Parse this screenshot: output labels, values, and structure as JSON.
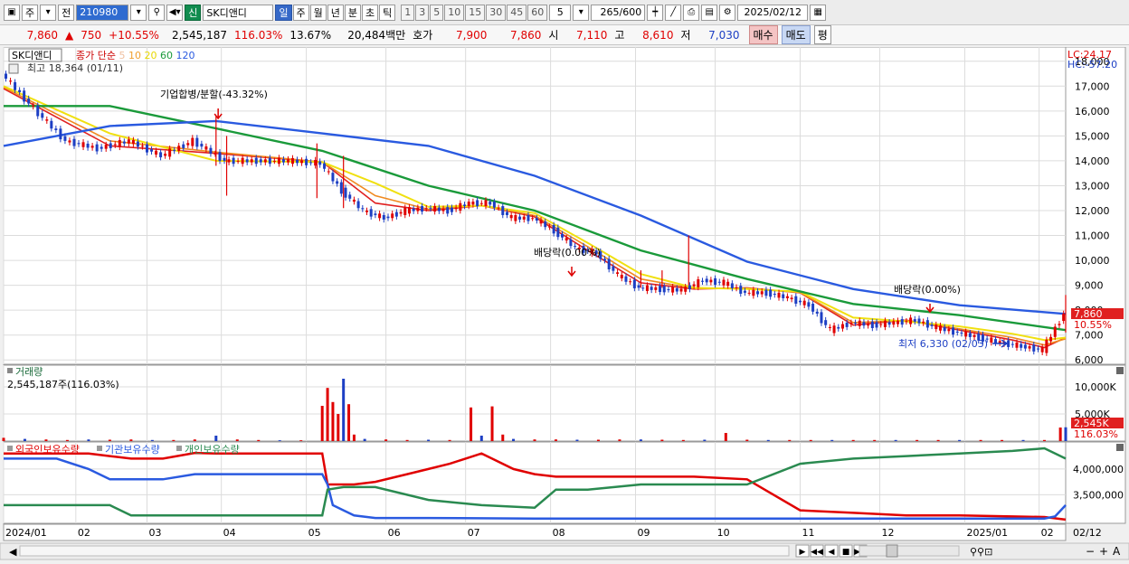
{
  "toolbar": {
    "period_type": "주",
    "market": "전",
    "code": "210980",
    "badge": "신",
    "stock_name": "SK디앤디",
    "periods": [
      "일",
      "주",
      "월",
      "년",
      "분",
      "초",
      "틱"
    ],
    "active_period": "일",
    "intervals": [
      "1",
      "3",
      "5",
      "10",
      "15",
      "30",
      "45",
      "60"
    ],
    "custom_interval": "5",
    "count": "265",
    "count_max": "/600",
    "date": "2025/02/12"
  },
  "quote": {
    "price": "7,860",
    "change": "750",
    "change_pct": "+10.55%",
    "volume": "2,545,187",
    "volume_ratio": "116.03%",
    "turnover": "13.67%",
    "amount": "20,484백만",
    "ask_label": "호가",
    "ask": "7,900",
    "bid": "7,860",
    "open_label": "시",
    "open": "7,110",
    "high_label": "고",
    "high": "8,610",
    "low_label": "저",
    "low": "7,030",
    "buy_label": "매수",
    "sell_label": "매도",
    "eval_label": "평"
  },
  "colors": {
    "up": "#e00000",
    "down": "#1d3fc4",
    "ma5": "#e02020",
    "ma10": "#f08a20",
    "ma20": "#f0e010",
    "ma60": "#1a9a3a",
    "ma120": "#2a5ae0",
    "foreign": "#e00000",
    "institution": "#2a5ae0",
    "individual": "#2a8a50"
  },
  "chart_data": [
    {
      "type": "line",
      "title": "SK디앤디",
      "legend": "종가 단순 5 10 20 60 120",
      "legend_items": [
        {
          "name": "5",
          "color": "#f0c0a0"
        },
        {
          "name": "10",
          "color": "#f0a030"
        },
        {
          "name": "20",
          "color": "#e8d800"
        },
        {
          "name": "60",
          "color": "#1a9a3a"
        },
        {
          "name": "120",
          "color": "#2a5ae0"
        }
      ],
      "max_label": "최고 18,364 (01/11)",
      "min_label": "최저 6,330 (02/03)",
      "annotations": [
        "기업합병/분할(-43.32%)",
        "배당락(0.00%)",
        "배당락(0.00%)"
      ],
      "right_top": [
        "LC:24.17",
        "HC:-57.20"
      ],
      "last_price": "7,860",
      "last_pct": "10.55%",
      "y_ticks": [
        "18,000",
        "17,000",
        "16,000",
        "15,000",
        "14,000",
        "13,000",
        "12,000",
        "11,000",
        "10,000",
        "9,000",
        "8,000",
        "7,000",
        "6,000"
      ],
      "ylim": [
        5900,
        18500
      ],
      "x_labels": [
        "2024/01",
        "02",
        "03",
        "04",
        "05",
        "06",
        "07",
        "08",
        "09",
        "10",
        "11",
        "12",
        "2025/01",
        "02"
      ],
      "x_label_last": "02/12",
      "series": [
        {
          "name": "close",
          "x": [
            0,
            3,
            6,
            9,
            12,
            15,
            18,
            21,
            24,
            27,
            30,
            32,
            34,
            36,
            38,
            40,
            42,
            44,
            46,
            48,
            50,
            52,
            54,
            56,
            58,
            60,
            62,
            64,
            66,
            68,
            70,
            72,
            74,
            76,
            78,
            80,
            82,
            84,
            86,
            88,
            90,
            92,
            94,
            96,
            98,
            100
          ],
          "values": [
            17500,
            16100,
            14800,
            14500,
            14800,
            14200,
            14800,
            14000,
            14000,
            14000,
            13900,
            12800,
            12000,
            11700,
            12000,
            12100,
            12000,
            12300,
            12300,
            11700,
            11700,
            11200,
            10500,
            10300,
            9400,
            8900,
            8850,
            8800,
            9200,
            9100,
            8700,
            8700,
            8500,
            8200,
            7200,
            7500,
            7400,
            7500,
            7600,
            7300,
            7100,
            6900,
            6700,
            6550,
            6400,
            7860
          ]
        },
        {
          "name": "5",
          "x": [
            0,
            10,
            20,
            30,
            35,
            40,
            45,
            50,
            55,
            60,
            65,
            70,
            75,
            80,
            85,
            90,
            95,
            98,
            100
          ],
          "values": [
            16900,
            14600,
            14300,
            13950,
            12300,
            12000,
            12200,
            11750,
            10400,
            9100,
            8850,
            8900,
            8700,
            7400,
            7600,
            7200,
            6800,
            6500,
            6900
          ]
        },
        {
          "name": "10",
          "x": [
            0,
            10,
            20,
            30,
            35,
            40,
            45,
            50,
            55,
            60,
            65,
            70,
            75,
            80,
            85,
            90,
            95,
            98,
            100
          ],
          "values": [
            16950,
            14800,
            14350,
            13950,
            12600,
            12050,
            12200,
            11800,
            10550,
            9250,
            8870,
            8880,
            8710,
            7500,
            7580,
            7250,
            6900,
            6600,
            6850
          ]
        },
        {
          "name": "20",
          "x": [
            0,
            10,
            20,
            30,
            35,
            40,
            45,
            50,
            55,
            60,
            65,
            70,
            75,
            80,
            85,
            90,
            95,
            98,
            100
          ],
          "values": [
            17000,
            15100,
            14000,
            13950,
            13100,
            12150,
            12200,
            11900,
            10700,
            9450,
            8900,
            8850,
            8740,
            7700,
            7550,
            7350,
            7050,
            6800,
            6900
          ]
        },
        {
          "name": "60",
          "x": [
            0,
            10,
            20,
            30,
            40,
            50,
            60,
            70,
            80,
            90,
            100
          ],
          "values": [
            16200,
            16200,
            15300,
            14400,
            13000,
            12000,
            10400,
            9250,
            8250,
            7800,
            7200
          ]
        },
        {
          "name": "120",
          "x": [
            0,
            10,
            20,
            30,
            40,
            50,
            60,
            70,
            80,
            90,
            100
          ],
          "values": [
            14600,
            15400,
            15600,
            15100,
            14600,
            13400,
            11800,
            9950,
            8850,
            8200,
            7850
          ]
        }
      ]
    },
    {
      "type": "bar",
      "title": "거래량",
      "subtitle": "2,545,187주(116.03%)",
      "y_ticks": [
        "10,000K",
        "5,000K"
      ],
      "ylim": [
        0,
        13000
      ],
      "last_label": "2,545K",
      "last_pct": "116.03%",
      "series": [
        {
          "name": "volume",
          "x": [
            0,
            2,
            4,
            6,
            8,
            10,
            12,
            14,
            16,
            18,
            20,
            22,
            24,
            26,
            28,
            30,
            30.5,
            31,
            31.5,
            32,
            32.5,
            33,
            34,
            36,
            38,
            40,
            42,
            44,
            45,
            46,
            47,
            48,
            50,
            52,
            54,
            56,
            58,
            60,
            62,
            64,
            66,
            68,
            70,
            72,
            74,
            76,
            78,
            80,
            82,
            84,
            86,
            88,
            90,
            92,
            94,
            96,
            98,
            99.5,
            100
          ],
          "values": [
            600,
            400,
            300,
            200,
            300,
            250,
            300,
            200,
            200,
            300,
            1000,
            300,
            200,
            150,
            150,
            6500,
            9800,
            7200,
            5000,
            11500,
            6800,
            1200,
            400,
            300,
            200,
            250,
            200,
            6200,
            1000,
            6400,
            1200,
            400,
            300,
            300,
            250,
            250,
            300,
            300,
            250,
            200,
            250,
            1500,
            250,
            200,
            200,
            200,
            200,
            200,
            200,
            200,
            200,
            200,
            200,
            200,
            200,
            200,
            200,
            2500,
            2545
          ]
        }
      ]
    },
    {
      "type": "line",
      "title": "외국인보유수량 · 기관보유수량 · 개인보유수량",
      "legend_items": [
        "외국인보유수량",
        "기관보유수량",
        "개인보유수량"
      ],
      "y_ticks": [
        "4,000,000",
        "3,500,000"
      ],
      "ylim": [
        3000000,
        4400000
      ],
      "series": [
        {
          "name": "외국인보유수량",
          "x": [
            0,
            8,
            10,
            12,
            15,
            18,
            20,
            25,
            28,
            30,
            30.5,
            33,
            35,
            38,
            40,
            42,
            45,
            48,
            50,
            52,
            55,
            60,
            65,
            70,
            75,
            80,
            85,
            90,
            95,
            98,
            100
          ],
          "values": [
            4300000,
            4300000,
            4250000,
            4200000,
            4200000,
            4310000,
            4300000,
            4300000,
            4300000,
            4300000,
            3700000,
            3700000,
            3750000,
            3900000,
            4000000,
            4100000,
            4300000,
            4000000,
            3900000,
            3850000,
            3850000,
            3850000,
            3850000,
            3800000,
            3200000,
            3150000,
            3100000,
            3100000,
            3080000,
            3070000,
            3020000
          ]
        },
        {
          "name": "기관보유수량",
          "x": [
            0,
            5,
            8,
            10,
            12,
            15,
            18,
            20,
            25,
            28,
            30,
            30.5,
            31,
            33,
            35,
            40,
            50,
            60,
            70,
            80,
            90,
            98,
            99,
            100
          ],
          "values": [
            4200000,
            4200000,
            4000000,
            3800000,
            3800000,
            3800000,
            3900000,
            3900000,
            3900000,
            3900000,
            3900000,
            3700000,
            3300000,
            3100000,
            3050000,
            3050000,
            3040000,
            3040000,
            3040000,
            3040000,
            3040000,
            3040000,
            3080000,
            3300000
          ]
        },
        {
          "name": "개인보유수량",
          "x": [
            0,
            5,
            10,
            12,
            15,
            18,
            20,
            25,
            28,
            30,
            30.5,
            32,
            35,
            40,
            45,
            50,
            52,
            55,
            60,
            65,
            70,
            75,
            80,
            85,
            90,
            95,
            98,
            100
          ],
          "values": [
            3300000,
            3300000,
            3300000,
            3100000,
            3100000,
            3100000,
            3100000,
            3100000,
            3100000,
            3100000,
            3600000,
            3650000,
            3650000,
            3400000,
            3300000,
            3250000,
            3600000,
            3600000,
            3700000,
            3700000,
            3700000,
            4100000,
            4200000,
            4250000,
            4300000,
            4350000,
            4400000,
            4200000
          ]
        }
      ]
    }
  ],
  "bottom_bar": {
    "controls": [
      "▶",
      "◀◀",
      "◀",
      "■",
      "▶▶"
    ],
    "zoom": [
      "−",
      "+",
      "A"
    ]
  }
}
